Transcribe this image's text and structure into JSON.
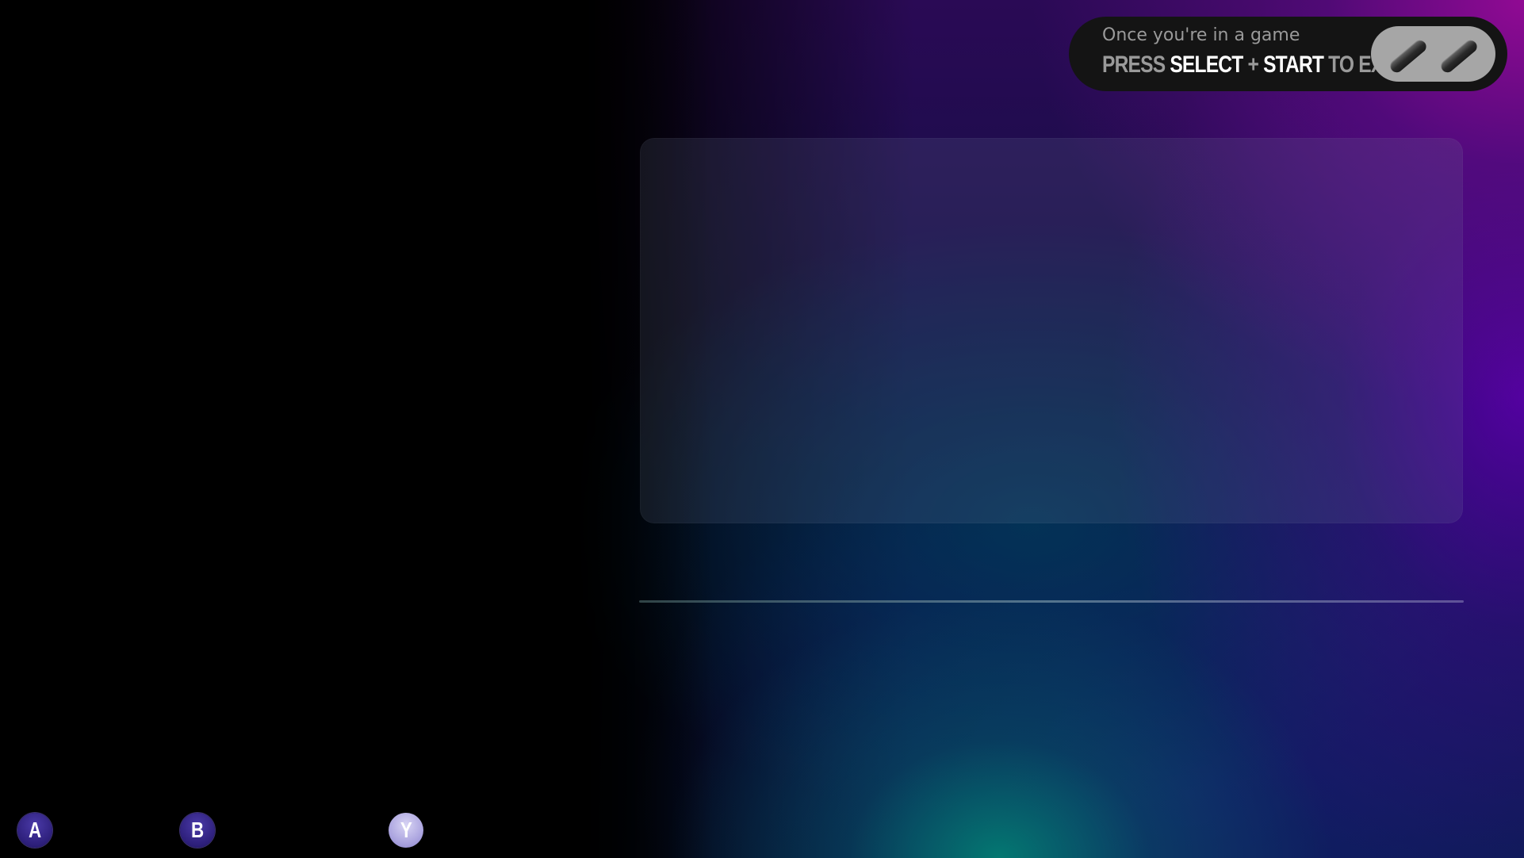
{
  "exit_hint": {
    "line1": "Once you're in a game",
    "press": "PRESS",
    "select": "SELECT",
    "plus": "+",
    "start": "START",
    "to_exit": "TO EXIT",
    "graphic_icon": "select-start-buttons-icon"
  },
  "preview": {
    "empty": true
  },
  "footer_buttons": [
    {
      "label": "A",
      "icon": "a-button-icon"
    },
    {
      "label": "B",
      "icon": "b-button-icon"
    },
    {
      "label": "Y",
      "icon": "y-button-icon"
    }
  ],
  "colors": {
    "background": "#000000",
    "accent_purple": "#8a0f9a",
    "accent_teal": "#007a66",
    "hint_bg": "#141414",
    "hint_text": "#9a9a9a",
    "hint_highlight": "#ffffff",
    "button_dark": "#2d1f7a",
    "button_light": "#a9a2de"
  }
}
